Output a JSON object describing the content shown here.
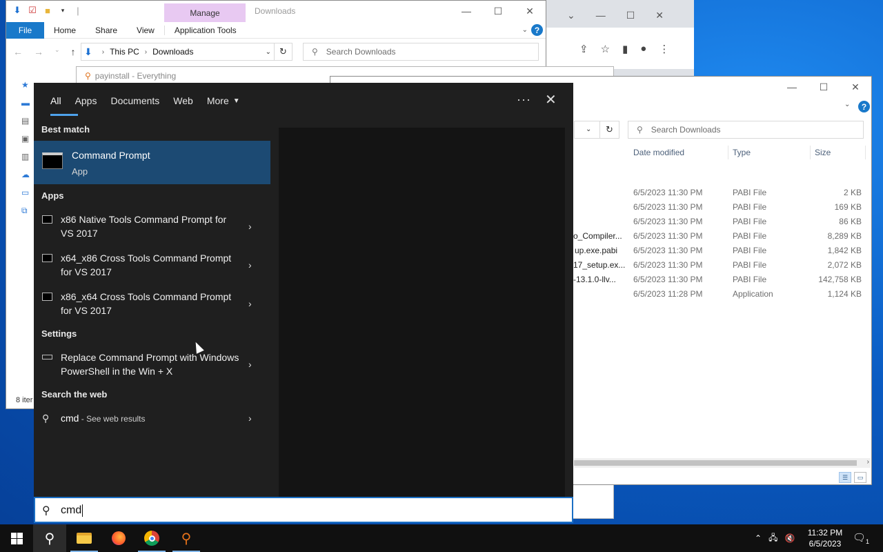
{
  "explorer_back": {
    "title": "Downloads",
    "manage_tab": "Manage",
    "ribbon": {
      "file": "File",
      "home": "Home",
      "share": "Share",
      "view": "View",
      "app_tools": "Application Tools"
    },
    "breadcrumb": {
      "root": "This PC",
      "folder": "Downloads"
    },
    "search_placeholder": "Search Downloads",
    "status": "8 iter"
  },
  "everything_window": {
    "title": "payinstall - Everything"
  },
  "explorer_front": {
    "search_placeholder": "Search Downloads",
    "columns": {
      "date": "Date modified",
      "type": "Type",
      "size": "Size"
    },
    "files": [
      {
        "name": "",
        "date": "6/5/2023 11:30 PM",
        "type": "PABI File",
        "size": "2 KB"
      },
      {
        "name": "",
        "date": "6/5/2023 11:30 PM",
        "type": "PABI File",
        "size": "169 KB"
      },
      {
        "name": "",
        "date": "6/5/2023 11:30 PM",
        "type": "PABI File",
        "size": "86 KB"
      },
      {
        "name": "o_Compiler...",
        "date": "6/5/2023 11:30 PM",
        "type": "PABI File",
        "size": "8,289 KB"
      },
      {
        "name": "up.exe.pabi",
        "date": "6/5/2023 11:30 PM",
        "type": "PABI File",
        "size": "1,842 KB"
      },
      {
        "name": "17_setup.ex...",
        "date": "6/5/2023 11:30 PM",
        "type": "PABI File",
        "size": "2,072 KB"
      },
      {
        "name": "-13.1.0-llv...",
        "date": "6/5/2023 11:30 PM",
        "type": "PABI File",
        "size": "142,758 KB"
      },
      {
        "name": "",
        "date": "6/5/2023 11:28 PM",
        "type": "Application",
        "size": "1,124 KB"
      }
    ]
  },
  "search": {
    "tabs": [
      "All",
      "Apps",
      "Documents",
      "Web",
      "More"
    ],
    "best_match_header": "Best match",
    "best_match": {
      "title": "Command Prompt",
      "subtitle": "App"
    },
    "apps_header": "Apps",
    "apps": [
      "x86 Native Tools Command Prompt for VS 2017",
      "x64_x86 Cross Tools Command Prompt for VS 2017",
      "x86_x64 Cross Tools Command Prompt for VS 2017"
    ],
    "settings_header": "Settings",
    "settings": [
      "Replace Command Prompt with Windows PowerShell in the Win + X"
    ],
    "web_header": "Search the web",
    "web_query": "cmd",
    "web_suffix": " - See web results",
    "query": "cmd"
  },
  "taskbar": {
    "time": "11:32 PM",
    "date": "6/5/2023",
    "notification_count": "1"
  }
}
